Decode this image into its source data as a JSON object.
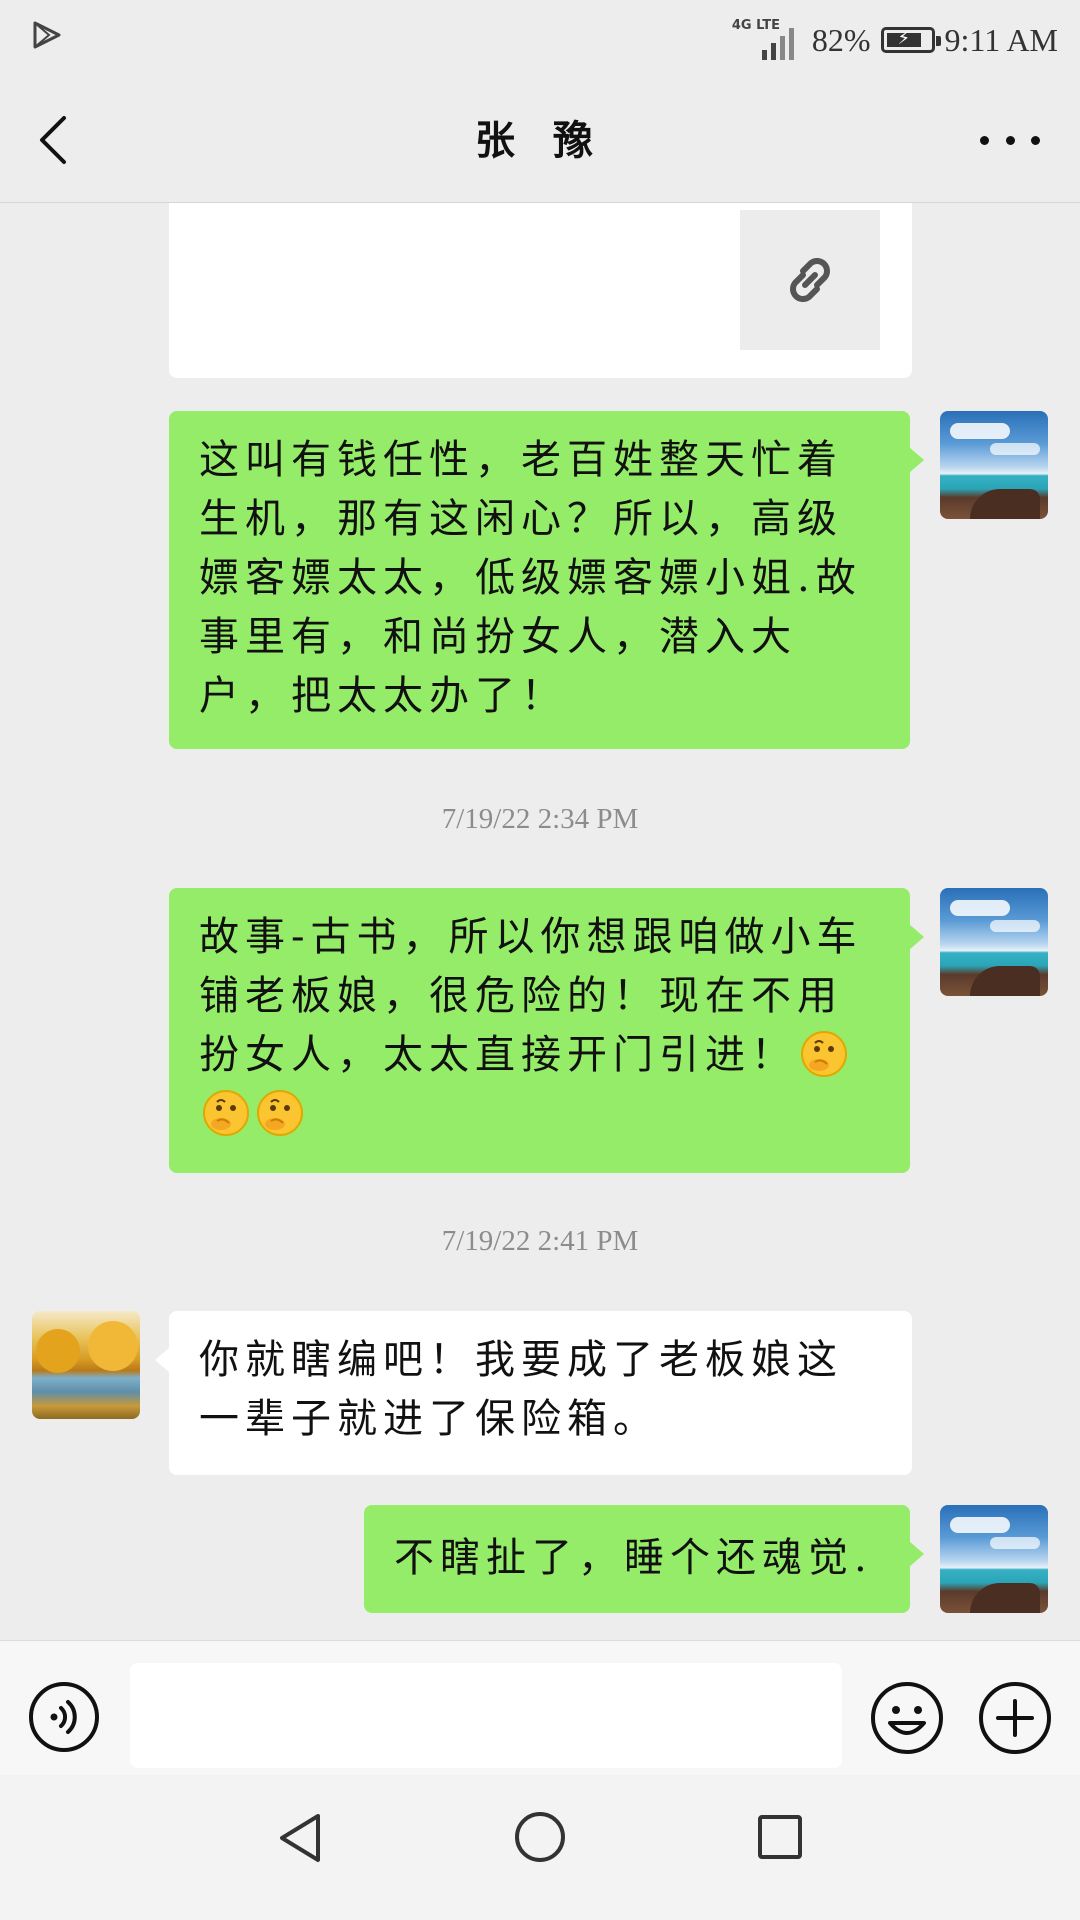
{
  "status_bar": {
    "network": "4G LTE",
    "battery": "82%",
    "battery_level": 0.82,
    "time": "9:11 AM"
  },
  "nav": {
    "title": "张 豫",
    "back_icon": "chevron-left-icon",
    "more_icon": "more-icon"
  },
  "messages": [
    {
      "side": "right",
      "text": "这叫有钱任性，老百姓整天忙着生机，那有这闲心？所以，高级嫖客嫖太太，低级嫖客嫖小姐.故事里有，和尚扮女人，潜入大户，把太太办了！"
    },
    {
      "timestamp": "7/19/22 2:34 PM"
    },
    {
      "side": "right",
      "text": "故事-古书，所以你想跟咱做小车铺老板娘，很危险的！现在不用扮女人，太太直接开门引进！",
      "emoji": "thinking-face"
    },
    {
      "timestamp": "7/19/22 2:41 PM"
    },
    {
      "side": "left",
      "text": "你就瞎编吧！我要成了老板娘这一辈子就进了保险箱。"
    },
    {
      "side": "right",
      "text": "不瞎扯了，睡个还魂觉."
    }
  ],
  "input": {
    "placeholder": "",
    "voice_icon": "voice-icon",
    "emoji_icon": "smiley-icon",
    "plus_icon": "plus-icon"
  },
  "system_nav": {
    "back_icon": "triangle-back-icon",
    "home_icon": "circle-home-icon",
    "recent_icon": "square-recent-icon"
  }
}
